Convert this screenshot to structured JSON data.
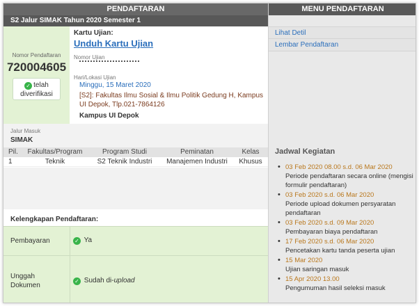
{
  "left_header": "PENDAFTARAN",
  "right_header": "MENU PENDAFTARAN",
  "subheader": "S2 Jalur SIMAK Tahun 2020 Semester 1",
  "registration": {
    "label": "Nomor Pendaftaran",
    "number": "720004605",
    "verified": "telah diverifikasi"
  },
  "exam_card": {
    "label": "Kartu Ujian:",
    "download_link": "Unduh Kartu Ujian",
    "exam_number_label": "Nomor Ujian",
    "date_location_label": "Hari/Lokasi Ujian",
    "date": "Minggu, 15 Maret 2020",
    "location": "[S2]: Fakultas Ilmu Sosial & Ilmu Politik Gedung H, Kampus UI Depok, Tlp.021-7864126",
    "campus": "Kampus UI Depok"
  },
  "jalur": {
    "label": "Jalur Masuk",
    "value": "SIMAK"
  },
  "table": {
    "headers": [
      "Pil.",
      "Fakultas/Program",
      "Program Studi",
      "Peminatan",
      "Kelas"
    ],
    "rows": [
      [
        "1",
        "Teknik",
        "S2 Teknik Industri",
        "Manajemen Industri",
        "Khusus"
      ]
    ]
  },
  "kelengkapan": {
    "title": "Kelengkapan Pendaftaran:",
    "payment_label": "Pembayaran",
    "payment_value": "Ya",
    "upload_label_1": "Unggah",
    "upload_label_2": "Dokumen",
    "upload_value": "Sudah di-",
    "upload_value_em": "upload"
  },
  "menu": [
    "Lihat Detil",
    "Lembar Pendaftaran"
  ],
  "jadwal_title": "Jadwal Kegiatan",
  "schedule": [
    {
      "date": "03 Feb 2020 08.00 s.d. 06 Mar 2020",
      "text": "Periode pendaftaran secara online (mengisi formulir pendaftaran)"
    },
    {
      "date": "03 Feb 2020 s.d. 06 Mar 2020",
      "text": "Periode upload dokumen persyaratan pendaftaran"
    },
    {
      "date": "03 Feb 2020 s.d. 09 Mar 2020",
      "text": "Pembayaran biaya pendaftaran"
    },
    {
      "date": "17 Feb 2020 s.d. 06 Mar 2020",
      "text": "Pencetakan kartu tanda peserta ujian"
    },
    {
      "date": "15 Mar 2020",
      "text": "Ujian saringan masuk"
    },
    {
      "date": "15 Apr 2020 13.00",
      "text": "Pengumuman hasil seleksi masuk"
    }
  ],
  "colors": {
    "accent_link": "#2a6ebb",
    "date_orange": "#b9771c",
    "success": "#38b449",
    "header_grey": "#686868"
  },
  "icons": {
    "verified": "check-circle-icon",
    "payment": "check-circle-icon",
    "upload": "check-circle-icon"
  }
}
